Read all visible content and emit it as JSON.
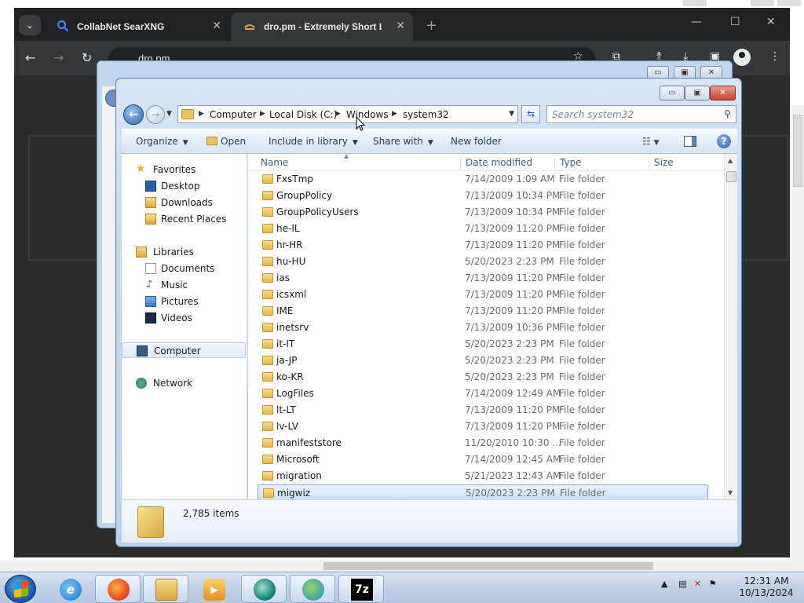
{
  "browser": {
    "tabs": [
      {
        "label": "CollabNet SearXNG",
        "close": "✕"
      },
      {
        "label": "dro.pm - Extremely Short Links",
        "close": "✕"
      }
    ],
    "new_tab": "+",
    "url": "dro.pm",
    "window_controls": [
      "—",
      "☐",
      "✕"
    ]
  },
  "explorer": {
    "title_buttons": {
      "minimize": "▭",
      "maximize": "▣",
      "close": "✕"
    },
    "breadcrumb": [
      "Computer",
      "Local Disk (C:)",
      "Windows",
      "system32"
    ],
    "search_placeholder": "Search system32",
    "commands": {
      "organize": "Organize",
      "open": "Open",
      "include_in_library": "Include in library",
      "share_with": "Share with",
      "new_folder": "New folder"
    },
    "nav": {
      "favorites": "Favorites",
      "desktop": "Desktop",
      "downloads": "Downloads",
      "recent_places": "Recent Places",
      "libraries": "Libraries",
      "documents": "Documents",
      "music": "Music",
      "pictures": "Pictures",
      "videos": "Videos",
      "computer": "Computer",
      "network": "Network"
    },
    "columns": {
      "name": "Name",
      "date_modified": "Date modified",
      "type": "Type",
      "size": "Size"
    },
    "files": [
      {
        "name": "FxsTmp",
        "date": "7/14/2009 1:09 AM",
        "type": "File folder"
      },
      {
        "name": "GroupPolicy",
        "date": "7/13/2009 10:34 PM",
        "type": "File folder"
      },
      {
        "name": "GroupPolicyUsers",
        "date": "7/13/2009 10:34 PM",
        "type": "File folder"
      },
      {
        "name": "he-IL",
        "date": "7/13/2009 11:20 PM",
        "type": "File folder"
      },
      {
        "name": "hr-HR",
        "date": "7/13/2009 11:20 PM",
        "type": "File folder"
      },
      {
        "name": "hu-HU",
        "date": "5/20/2023 2:23 PM",
        "type": "File folder"
      },
      {
        "name": "ias",
        "date": "7/13/2009 11:20 PM",
        "type": "File folder"
      },
      {
        "name": "icsxml",
        "date": "7/13/2009 11:20 PM",
        "type": "File folder"
      },
      {
        "name": "IME",
        "date": "7/13/2009 11:20 PM",
        "type": "File folder"
      },
      {
        "name": "inetsrv",
        "date": "7/13/2009 10:36 PM",
        "type": "File folder"
      },
      {
        "name": "it-IT",
        "date": "5/20/2023 2:23 PM",
        "type": "File folder"
      },
      {
        "name": "ja-JP",
        "date": "5/20/2023 2:23 PM",
        "type": "File folder"
      },
      {
        "name": "ko-KR",
        "date": "5/20/2023 2:23 PM",
        "type": "File folder"
      },
      {
        "name": "LogFiles",
        "date": "7/14/2009 12:49 AM",
        "type": "File folder"
      },
      {
        "name": "lt-LT",
        "date": "7/13/2009 11:20 PM",
        "type": "File folder"
      },
      {
        "name": "lv-LV",
        "date": "7/13/2009 11:20 PM",
        "type": "File folder"
      },
      {
        "name": "manifeststore",
        "date": "11/20/2010 10:30 ...",
        "type": "File folder"
      },
      {
        "name": "Microsoft",
        "date": "7/14/2009 12:45 AM",
        "type": "File folder"
      },
      {
        "name": "migration",
        "date": "5/21/2023 12:43 AM",
        "type": "File folder"
      },
      {
        "name": "migwiz",
        "date": "5/20/2023 2:23 PM",
        "type": "File folder",
        "selected": true
      }
    ],
    "status": {
      "item_count": "2,785 items"
    }
  },
  "taskbar": {
    "apps": [
      "internet-explorer",
      "firefox",
      "file-explorer",
      "media-player",
      "app-circle",
      "network-app",
      "7-zip"
    ],
    "seven_zip_label": "7z",
    "time": "12:31 AM",
    "date": "10/13/2024"
  },
  "colors": {
    "accent": "#2d64b4",
    "chrome_bg": "#202124",
    "selection": "#cce2f9"
  }
}
